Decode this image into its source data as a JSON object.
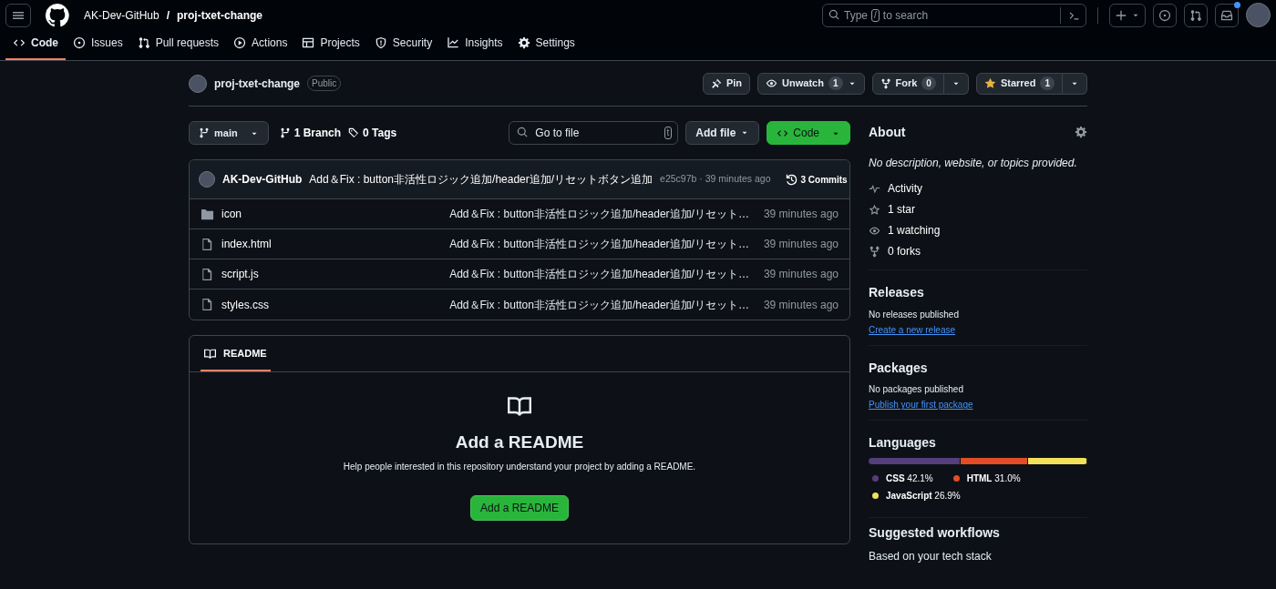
{
  "header": {
    "owner": "AK-Dev-GitHub",
    "separator": "/",
    "repo": "proj-txet-change",
    "search": {
      "before": "Type",
      "key": "/",
      "after": "to search"
    },
    "notification_unread": true
  },
  "tabs": [
    {
      "label": "Code",
      "selected": true
    },
    {
      "label": "Issues",
      "selected": false
    },
    {
      "label": "Pull requests",
      "selected": false
    },
    {
      "label": "Actions",
      "selected": false
    },
    {
      "label": "Projects",
      "selected": false
    },
    {
      "label": "Security",
      "selected": false
    },
    {
      "label": "Insights",
      "selected": false
    },
    {
      "label": "Settings",
      "selected": false
    }
  ],
  "repo_header": {
    "name": "proj-txet-change",
    "visibility": "Public",
    "pin": "Pin",
    "watch": {
      "label": "Unwatch",
      "count": "1"
    },
    "fork": {
      "label": "Fork",
      "count": "0"
    },
    "star": {
      "label": "Starred",
      "count": "1",
      "starred": true
    }
  },
  "toolbar": {
    "branch": "main",
    "branches": "1 Branch",
    "tags": "0 Tags",
    "go_to_file": {
      "placeholder": "Go to file",
      "key": "t"
    },
    "add_file": "Add file",
    "code": "Code"
  },
  "latest_commit": {
    "author": "AK-Dev-GitHub",
    "message": "Add＆Fix : button非活性ロジック追加/header追加/リセットボタン追加",
    "hash_time": "e25c97b · 39 minutes ago",
    "commits": "3 Commits"
  },
  "files": [
    {
      "kind": "folder",
      "name": "icon",
      "message": "Add＆Fix : button非活性ロジック追加/header追加/リセット…",
      "time": "39 minutes ago"
    },
    {
      "kind": "file",
      "name": "index.html",
      "message": "Add＆Fix : button非活性ロジック追加/header追加/リセット…",
      "time": "39 minutes ago"
    },
    {
      "kind": "file",
      "name": "script.js",
      "message": "Add＆Fix : button非活性ロジック追加/header追加/リセット…",
      "time": "39 minutes ago"
    },
    {
      "kind": "file",
      "name": "styles.css",
      "message": "Add＆Fix : button非活性ロジック追加/header追加/リセット…",
      "time": "39 minutes ago"
    }
  ],
  "readme": {
    "tab": "README",
    "title": "Add a README",
    "text": "Help people interested in this repository understand your project by adding a README.",
    "button": "Add a README"
  },
  "about": {
    "title": "About",
    "description": "No description, website, or topics provided.",
    "items": [
      {
        "label": "Activity"
      },
      {
        "label": "1 star"
      },
      {
        "label": "1 watching"
      },
      {
        "label": "0 forks"
      }
    ]
  },
  "releases": {
    "title": "Releases",
    "text": "No releases published",
    "link": "Create a new release"
  },
  "packages": {
    "title": "Packages",
    "text": "No packages published",
    "link": "Publish your first package"
  },
  "languages": {
    "title": "Languages",
    "items": [
      {
        "name": "CSS",
        "percent": "42.1%",
        "color": "#563d7c"
      },
      {
        "name": "HTML",
        "percent": "31.0%",
        "color": "#e34c26"
      },
      {
        "name": "JavaScript",
        "percent": "26.9%",
        "color": "#f1e05a"
      }
    ]
  },
  "workflows": {
    "title": "Suggested workflows",
    "text": "Based on your tech stack"
  }
}
